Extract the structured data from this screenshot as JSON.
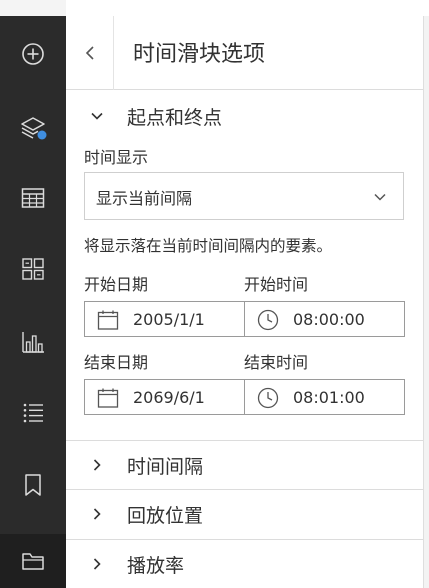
{
  "rail": {
    "items": [
      {
        "icon": "add-circle-icon"
      },
      {
        "icon": "layers-icon",
        "badge_color": "#3f8ee0"
      },
      {
        "icon": "table-icon"
      },
      {
        "icon": "grid-widgets-icon"
      },
      {
        "icon": "bar-chart-icon"
      },
      {
        "icon": "list-icon"
      },
      {
        "icon": "bookmark-icon"
      },
      {
        "icon": "folder-icon"
      }
    ]
  },
  "panel": {
    "title": "时间滑块选项",
    "sections": {
      "start_end": {
        "title": "起点和终点",
        "expanded": true,
        "time_display_label": "时间显示",
        "time_display_value": "显示当前间隔",
        "description": "将显示落在当前时间间隔内的要素。",
        "start_date_label": "开始日期",
        "start_time_label": "开始时间",
        "start_date": "2005/1/1",
        "start_time": "08:00:00",
        "end_date_label": "结束日期",
        "end_time_label": "结束时间",
        "end_date": "2069/6/1",
        "end_time": "08:01:00"
      },
      "interval": {
        "title": "时间间隔",
        "expanded": false
      },
      "playback_position": {
        "title": "回放位置",
        "expanded": false
      },
      "playback_rate": {
        "title": "播放率",
        "expanded": false
      }
    }
  },
  "colors": {
    "rail_bg": "#2b2b2b",
    "icon": "#dcdcdc",
    "text": "#323232",
    "accent_badge": "#3f8ee0"
  }
}
